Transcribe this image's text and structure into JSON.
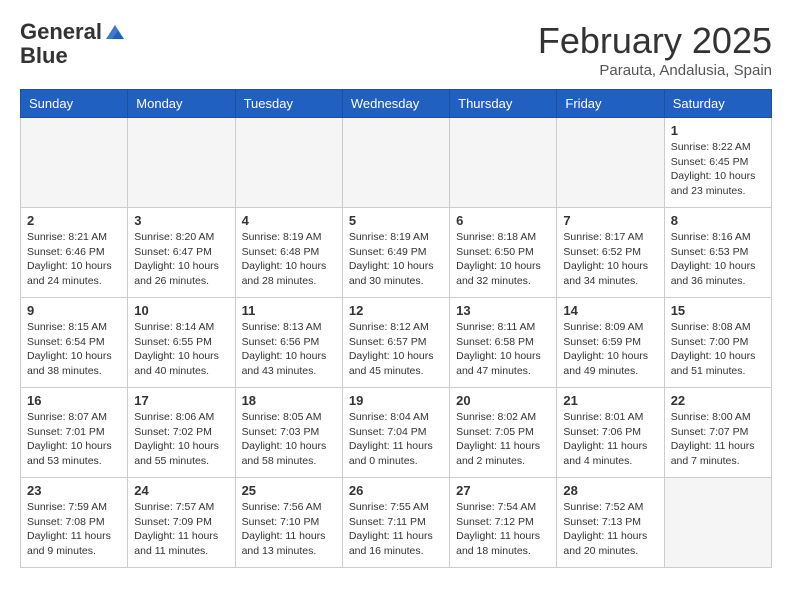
{
  "header": {
    "logo_general": "General",
    "logo_blue": "Blue",
    "month_title": "February 2025",
    "location": "Parauta, Andalusia, Spain"
  },
  "weekdays": [
    "Sunday",
    "Monday",
    "Tuesday",
    "Wednesday",
    "Thursday",
    "Friday",
    "Saturday"
  ],
  "weeks": [
    [
      {
        "day": "",
        "info": ""
      },
      {
        "day": "",
        "info": ""
      },
      {
        "day": "",
        "info": ""
      },
      {
        "day": "",
        "info": ""
      },
      {
        "day": "",
        "info": ""
      },
      {
        "day": "",
        "info": ""
      },
      {
        "day": "1",
        "info": "Sunrise: 8:22 AM\nSunset: 6:45 PM\nDaylight: 10 hours and 23 minutes."
      }
    ],
    [
      {
        "day": "2",
        "info": "Sunrise: 8:21 AM\nSunset: 6:46 PM\nDaylight: 10 hours and 24 minutes."
      },
      {
        "day": "3",
        "info": "Sunrise: 8:20 AM\nSunset: 6:47 PM\nDaylight: 10 hours and 26 minutes."
      },
      {
        "day": "4",
        "info": "Sunrise: 8:19 AM\nSunset: 6:48 PM\nDaylight: 10 hours and 28 minutes."
      },
      {
        "day": "5",
        "info": "Sunrise: 8:19 AM\nSunset: 6:49 PM\nDaylight: 10 hours and 30 minutes."
      },
      {
        "day": "6",
        "info": "Sunrise: 8:18 AM\nSunset: 6:50 PM\nDaylight: 10 hours and 32 minutes."
      },
      {
        "day": "7",
        "info": "Sunrise: 8:17 AM\nSunset: 6:52 PM\nDaylight: 10 hours and 34 minutes."
      },
      {
        "day": "8",
        "info": "Sunrise: 8:16 AM\nSunset: 6:53 PM\nDaylight: 10 hours and 36 minutes."
      }
    ],
    [
      {
        "day": "9",
        "info": "Sunrise: 8:15 AM\nSunset: 6:54 PM\nDaylight: 10 hours and 38 minutes."
      },
      {
        "day": "10",
        "info": "Sunrise: 8:14 AM\nSunset: 6:55 PM\nDaylight: 10 hours and 40 minutes."
      },
      {
        "day": "11",
        "info": "Sunrise: 8:13 AM\nSunset: 6:56 PM\nDaylight: 10 hours and 43 minutes."
      },
      {
        "day": "12",
        "info": "Sunrise: 8:12 AM\nSunset: 6:57 PM\nDaylight: 10 hours and 45 minutes."
      },
      {
        "day": "13",
        "info": "Sunrise: 8:11 AM\nSunset: 6:58 PM\nDaylight: 10 hours and 47 minutes."
      },
      {
        "day": "14",
        "info": "Sunrise: 8:09 AM\nSunset: 6:59 PM\nDaylight: 10 hours and 49 minutes."
      },
      {
        "day": "15",
        "info": "Sunrise: 8:08 AM\nSunset: 7:00 PM\nDaylight: 10 hours and 51 minutes."
      }
    ],
    [
      {
        "day": "16",
        "info": "Sunrise: 8:07 AM\nSunset: 7:01 PM\nDaylight: 10 hours and 53 minutes."
      },
      {
        "day": "17",
        "info": "Sunrise: 8:06 AM\nSunset: 7:02 PM\nDaylight: 10 hours and 55 minutes."
      },
      {
        "day": "18",
        "info": "Sunrise: 8:05 AM\nSunset: 7:03 PM\nDaylight: 10 hours and 58 minutes."
      },
      {
        "day": "19",
        "info": "Sunrise: 8:04 AM\nSunset: 7:04 PM\nDaylight: 11 hours and 0 minutes."
      },
      {
        "day": "20",
        "info": "Sunrise: 8:02 AM\nSunset: 7:05 PM\nDaylight: 11 hours and 2 minutes."
      },
      {
        "day": "21",
        "info": "Sunrise: 8:01 AM\nSunset: 7:06 PM\nDaylight: 11 hours and 4 minutes."
      },
      {
        "day": "22",
        "info": "Sunrise: 8:00 AM\nSunset: 7:07 PM\nDaylight: 11 hours and 7 minutes."
      }
    ],
    [
      {
        "day": "23",
        "info": "Sunrise: 7:59 AM\nSunset: 7:08 PM\nDaylight: 11 hours and 9 minutes."
      },
      {
        "day": "24",
        "info": "Sunrise: 7:57 AM\nSunset: 7:09 PM\nDaylight: 11 hours and 11 minutes."
      },
      {
        "day": "25",
        "info": "Sunrise: 7:56 AM\nSunset: 7:10 PM\nDaylight: 11 hours and 13 minutes."
      },
      {
        "day": "26",
        "info": "Sunrise: 7:55 AM\nSunset: 7:11 PM\nDaylight: 11 hours and 16 minutes."
      },
      {
        "day": "27",
        "info": "Sunrise: 7:54 AM\nSunset: 7:12 PM\nDaylight: 11 hours and 18 minutes."
      },
      {
        "day": "28",
        "info": "Sunrise: 7:52 AM\nSunset: 7:13 PM\nDaylight: 11 hours and 20 minutes."
      },
      {
        "day": "",
        "info": ""
      }
    ]
  ]
}
